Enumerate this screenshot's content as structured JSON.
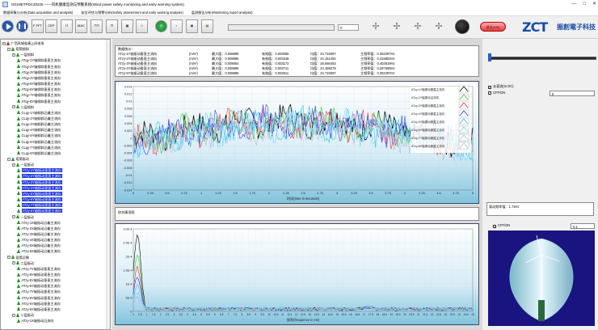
{
  "window": {
    "title": "G01NETPDC20225 ——风机健康监测与预警系统(Wind power safety monitoring and early warning system)",
    "controls": [
      "—",
      "□",
      "✕"
    ]
  },
  "menu": [
    "数据采集与分析(Data acquisition and analysis)",
    "安全评估与预警分析(Safety assessment and early warning analysis)",
    "监测报告分析(Monitoring report analysis)"
  ],
  "toolbar": {
    "buttons": [
      {
        "name": "play-button",
        "label": ""
      },
      {
        "name": "pause-button",
        "label": ""
      },
      {
        "name": "fft-button",
        "label": "F\nFFT"
      },
      {
        "name": "cep-button",
        "label": "CEP"
      },
      {
        "name": "filter-button",
        "label": "⌇⌇"
      },
      {
        "name": "mac-button",
        "label": "MAC"
      },
      {
        "name": "mode-button",
        "label": "⊓⊓"
      },
      {
        "name": "stats-button",
        "label": "ᑎ"
      },
      {
        "name": "report-button",
        "label": "▦"
      },
      {
        "name": "alarm-button",
        "label": "⚠"
      },
      {
        "name": "export-button",
        "label": "⊙"
      }
    ],
    "progress": {
      "value": "0",
      "fraction": 0.0
    },
    "turbine_icons": [
      "wind-turbine-icon",
      "wind-turbine-icon",
      "wind-turbine-icon",
      "wind-turbine-icon"
    ],
    "exit_label": "退出(exit)"
  },
  "logo": {
    "mark": "ZCT",
    "text": "振創電子科技"
  },
  "tree": {
    "items": [
      {
        "label": "广西凤城省事上风电场",
        "level": 0,
        "toggle": "−",
        "root": true
      },
      {
        "label": "塔筒倾斜",
        "level": 1,
        "toggle": "−"
      },
      {
        "label": "一层倾斜",
        "level": 2,
        "toggle": "−"
      },
      {
        "label": "ATqy-1Y轴倾斜垂直主流向",
        "level": 3
      },
      {
        "label": "ATqy-2Y轴倾斜垂直主流向",
        "level": 3
      },
      {
        "label": "ATqy-3Y轴倾斜垂直主流向",
        "level": 3
      },
      {
        "label": "ATqy-4Y轴倾斜垂直主流向",
        "level": 3
      },
      {
        "label": "ATqy-5Y轴倾斜垂直主流向",
        "level": 3
      },
      {
        "label": "ATqy-6Y轴倾斜垂直主流向",
        "level": 3
      },
      {
        "label": "ATqy-7Y轴倾斜垂直主流向",
        "level": 3
      },
      {
        "label": "ATqy-8Y轴倾斜垂直主流向",
        "level": 3
      },
      {
        "label": "二层倾斜",
        "level": 2,
        "toggle": "−"
      },
      {
        "label": "CLqy-1Y轴倾斜沿着主流向",
        "level": 3
      },
      {
        "label": "CLqy-2Y轴倾斜沿着主流向",
        "level": 3
      },
      {
        "label": "CLqy-3Y轴倾斜沿着主流向",
        "level": 3
      },
      {
        "label": "CLqy-4Y轴倾斜沿着主流向",
        "level": 3
      },
      {
        "label": "CLqy-5Y轴倾斜沿着主流向",
        "level": 3
      },
      {
        "label": "CLqy-6Y轴倾斜沿着主流向",
        "level": 3
      },
      {
        "label": "CLqy-7Y轴倾斜沿着主流向",
        "level": 3
      },
      {
        "label": "CLqy-8Y轴倾斜沿着主流向",
        "level": 3
      },
      {
        "label": "塔筒振动",
        "level": 1,
        "toggle": "−"
      },
      {
        "label": "一层振动",
        "level": 2,
        "toggle": "−"
      },
      {
        "label": "ATzy-1Y轴振动垂直主流向",
        "level": 3,
        "sel": true
      },
      {
        "label": "ATzy-2Y轴振动垂直主流向",
        "level": 3,
        "sel": true
      },
      {
        "label": "ATzy-3Y轴振动垂直主流向",
        "level": 3,
        "sel": true
      },
      {
        "label": "ATzy-4Y轴振动垂直主流向",
        "level": 3,
        "sel": true
      },
      {
        "label": "ATzy-5Y轴振动垂直主流向",
        "level": 3,
        "sel": true
      },
      {
        "label": "ATzy-6Y轴振动垂直主流向",
        "level": 3,
        "sel": true
      },
      {
        "label": "ATzy-7Y轴振动垂直主流向",
        "level": 3,
        "sel": true
      },
      {
        "label": "ATzy-8Y轴振动垂直主流向",
        "level": 3,
        "sel": true
      },
      {
        "label": "一层振动",
        "level": 2,
        "toggle": "−"
      },
      {
        "label": "ATzy-1X轴振动沿着主流向",
        "level": 3
      },
      {
        "label": "ATzy-2X轴振动沿着主流向",
        "level": 3
      },
      {
        "label": "ATzy-3X轴振动沿着主流向",
        "level": 3
      },
      {
        "label": "ATzy-4X轴振动沿着主流向",
        "level": 3
      },
      {
        "label": "ATzy-5X轴振动沿着主流向",
        "level": 3
      },
      {
        "label": "ATzy-6X轴振动沿着主流向",
        "level": 3
      },
      {
        "label": "塔筒沉降",
        "level": 1,
        "toggle": "−"
      },
      {
        "label": "二层振动",
        "level": 2,
        "toggle": "−"
      },
      {
        "label": "ATzy-7Y轴振动垂直主流向",
        "level": 3
      },
      {
        "label": "ATzy-8Y轴振动垂直主流向",
        "level": 3
      },
      {
        "label": "ATzy-5Y轴振动垂直主流向",
        "level": 3
      },
      {
        "label": "ATzy-6Y轴振动垂直主流向",
        "level": 3
      },
      {
        "label": "ATzy-7Y轴振动垂直主流向",
        "level": 3
      },
      {
        "label": "ATzy-8Y轴振动垂直主流向",
        "level": 3
      },
      {
        "label": "ATzy-5Y轴振动垂直主流向",
        "level": 3
      },
      {
        "label": "ATzy-6Y轴振动垂直主流向",
        "level": 3
      },
      {
        "label": "二层振动",
        "level": 2,
        "toggle": "−"
      },
      {
        "label": "ATzy-1X轴振动沿流向",
        "level": 3
      }
    ]
  },
  "info": {
    "header": "数据统计：",
    "rows": [
      {
        "name": "ATzy-1Y轴振动垂直主流向",
        "unit": "(m/s²)",
        "max": "最大值：0.008895",
        "rms": "有效值：0.003056",
        "mean": "均值：24.718397",
        "freq": "主频率值：0.302297Hz"
      },
      {
        "name": "ATzy-2Y轴振动垂直主流向",
        "unit": "(m/s²)",
        "max": "最大值：0.008895",
        "rms": "有效值：0.003248",
        "mean": "均值：24.151494",
        "freq": "主频率值：0.319802Hz"
      },
      {
        "name": "ATzy-3Y轴振动垂直主流向",
        "unit": "(m/s²)",
        "max": "最大值：0.009064",
        "rms": "有效值：0.003172",
        "mean": "均值：26.666493",
        "freq": "主频率值：0.402819Hz"
      },
      {
        "name": "ATzy-4Y轴振动垂直主流向",
        "unit": "(m/s²)",
        "max": "最大值：0.008895",
        "rms": "有效值：0.003711",
        "mean": "均值：24.188279",
        "freq": "主频率值：0.297608Hz"
      },
      {
        "name": "ATzy-5Y轴振动垂直主流向",
        "unit": "(m/s²)",
        "max": "最大值：0.008895",
        "rms": "有效值：0.003511",
        "mean": "均值：24.718397",
        "freq": "主频率值：0.302297Hz"
      }
    ]
  },
  "chart_time": {
    "type": "line",
    "xlabel": "时间(time in seconds)",
    "xlim": [
      0,
      5
    ],
    "ylim": [
      -0.014,
      0.014
    ],
    "x_ticks": [
      "0",
      "0.25",
      "0.5",
      "0.75",
      "1",
      "1.25",
      "1.5",
      "1.75",
      "2",
      "2.25",
      "2.5",
      "2.75",
      "3",
      "3.25",
      "3.5",
      "3.75",
      "4",
      "4.25",
      "4.5",
      "4.75",
      "5"
    ],
    "y_ticks": [
      "0.014",
      "0.012",
      "0.01",
      "0.008",
      "0.006",
      "0.004",
      "0.002",
      "0",
      "-0.002",
      "-0.004",
      "-0.006",
      "-0.008",
      "-0.01",
      "-0.012",
      "-0.014"
    ],
    "series": [
      {
        "name": "ATzy-1Y轴振动垂直主流向",
        "color": "#000000"
      },
      {
        "name": "ATzy-2Y轴振动沿流向",
        "color": "#33cc33"
      },
      {
        "name": "ATzy-3Y轴振动垂直主流向",
        "color": "#ff2020"
      },
      {
        "name": "ATzy-4Y轴振动垂直主流向",
        "color": "#2a2aff"
      },
      {
        "name": "ATzy-5Y轴振动垂直主流向",
        "color": "#20c8d8"
      },
      {
        "name": "ATzy-6Y轴振动垂直主流向",
        "color": "#6ad0ff"
      },
      {
        "name": "ATzy-7Y轴振动垂直主流向",
        "color": "#88ccff"
      },
      {
        "name": "ATzy-8Y轴振动垂直主流向",
        "color": "#bbbbbb"
      }
    ],
    "grid": true,
    "legend_position": "top-right"
  },
  "mid_label": "综合事项图",
  "chart_freq": {
    "type": "line",
    "xlabel": "频率(frequence in Hz)",
    "xlim": [
      0,
      25
    ],
    "ylim": [
      0,
      0.0003
    ],
    "y_ticks": [
      "3.0E-4",
      "2.5E-4",
      "2E-4",
      "1.5E-4",
      "1E-4",
      "5E-5",
      "0"
    ],
    "x_ticks": [
      "0",
      "0.5",
      "1",
      "1.5",
      "2",
      "2.5",
      "3",
      "3.5",
      "4",
      "4.5",
      "5",
      "5.5",
      "6",
      "6.5",
      "7",
      "7.5",
      "8",
      "8.5",
      "9",
      "9.5",
      "10",
      "10.5",
      "11",
      "11.5",
      "12",
      "12.5",
      "13",
      "13.5",
      "14",
      "14.5",
      "15",
      "15.5",
      "16",
      "16.5",
      "17",
      "17.5",
      "18",
      "18.5",
      "19",
      "19.5",
      "20",
      "20.5",
      "21",
      "21.5",
      "22",
      "22.5",
      "23",
      "23.5",
      "24",
      "24.5",
      "25"
    ],
    "grid": true
  },
  "right": {
    "checkbox1": {
      "label": "去直流(to DC)",
      "checked": true
    },
    "checkbox2": {
      "label": "CFF/ON",
      "checked": false
    },
    "field_value": "0",
    "freq_info": "晃动频率值：1.73Hz",
    "checkbox3": {
      "label": "CFF/ON",
      "checked": true
    },
    "field2_value": "0.1"
  }
}
